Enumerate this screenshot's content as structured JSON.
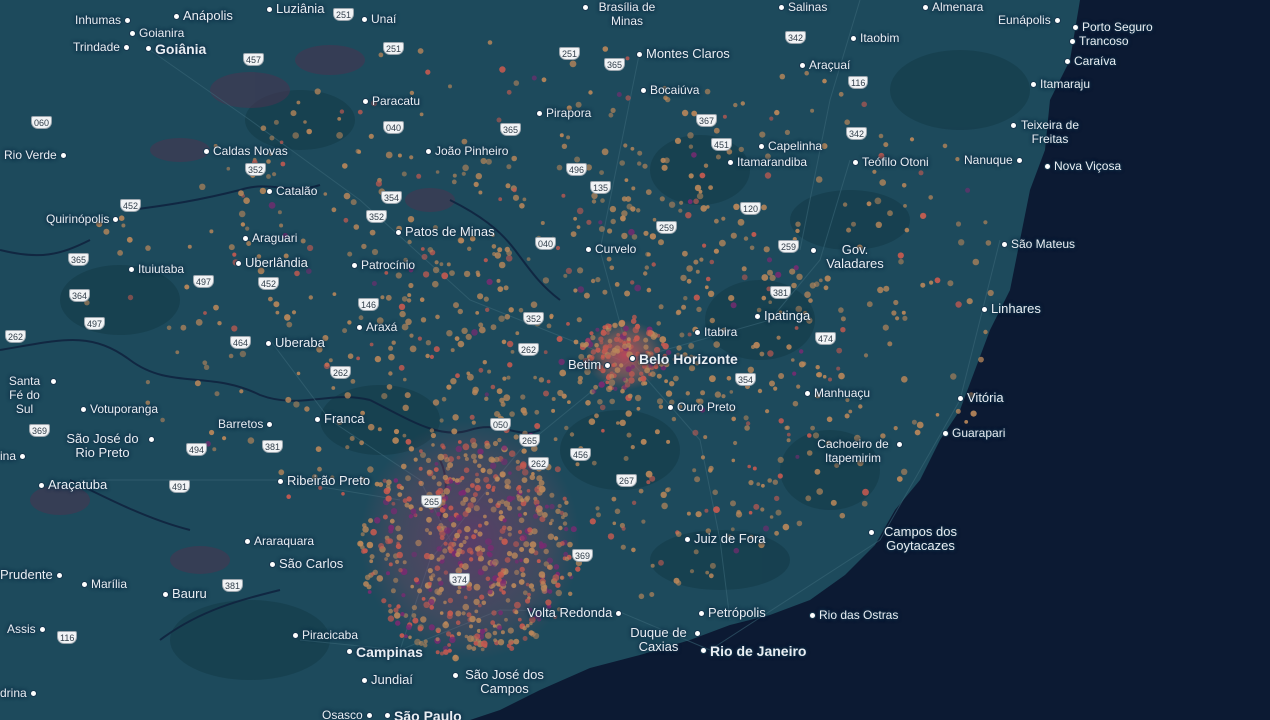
{
  "colors": {
    "ocean": "#0c1a33",
    "land": "#1d4a5c",
    "forest": "#17404f",
    "urban": "#4a3450",
    "heat_low": "#b9875a",
    "heat_mid": "#c65a50",
    "heat_high": "#7a2a72",
    "label": "#e9eef3",
    "shield_bg": "#f1f3f5"
  },
  "cities": [
    {
      "name": "Inhumas",
      "size": "small"
    },
    {
      "name": "Anápolis",
      "size": "medium"
    },
    {
      "name": "Luziânia",
      "size": "medium"
    },
    {
      "name": "Unaí",
      "size": "small"
    },
    {
      "name": "Goianira",
      "size": "small"
    },
    {
      "name": "Trindade",
      "size": "small"
    },
    {
      "name": "Goiânia",
      "size": "major"
    },
    {
      "name": "Brasília de Minas",
      "size": "small"
    },
    {
      "name": "Salinas",
      "size": "small"
    },
    {
      "name": "Almenara",
      "size": "small"
    },
    {
      "name": "Eunápolis",
      "size": "small"
    },
    {
      "name": "Porto Seguro",
      "size": "small"
    },
    {
      "name": "Trancoso",
      "size": "small"
    },
    {
      "name": "Montes Claros",
      "size": "medium"
    },
    {
      "name": "Itaobim",
      "size": "small"
    },
    {
      "name": "Caraíva",
      "size": "small"
    },
    {
      "name": "Araçuaí",
      "size": "small"
    },
    {
      "name": "Itamaraju",
      "size": "small"
    },
    {
      "name": "Bocaiúva",
      "size": "small"
    },
    {
      "name": "Paracatu",
      "size": "small"
    },
    {
      "name": "Pirapora",
      "size": "small"
    },
    {
      "name": "Teixeira de Freitas",
      "size": "small"
    },
    {
      "name": "Rio Verde",
      "size": "small"
    },
    {
      "name": "Caldas Novas",
      "size": "small"
    },
    {
      "name": "João Pinheiro",
      "size": "small"
    },
    {
      "name": "Capelinha",
      "size": "small"
    },
    {
      "name": "Itamarandiba",
      "size": "small"
    },
    {
      "name": "Teófilo Otoni",
      "size": "small"
    },
    {
      "name": "Nanuque",
      "size": "small"
    },
    {
      "name": "Nova Viçosa",
      "size": "small"
    },
    {
      "name": "Catalão",
      "size": "small"
    },
    {
      "name": "Quirinópolis",
      "size": "small"
    },
    {
      "name": "Patos de Minas",
      "size": "medium"
    },
    {
      "name": "Araguari",
      "size": "small"
    },
    {
      "name": "Curvelo",
      "size": "small"
    },
    {
      "name": "Gov. Valadares",
      "size": "medium"
    },
    {
      "name": "São Mateus",
      "size": "small"
    },
    {
      "name": "Uberlândia",
      "size": "medium"
    },
    {
      "name": "Ituiutaba",
      "size": "small"
    },
    {
      "name": "Patrocínio",
      "size": "small"
    },
    {
      "name": "Linhares",
      "size": "medium"
    },
    {
      "name": "Itabira",
      "size": "small"
    },
    {
      "name": "Ipatinga",
      "size": "medium"
    },
    {
      "name": "Araxá",
      "size": "small"
    },
    {
      "name": "Uberaba",
      "size": "medium"
    },
    {
      "name": "Betim",
      "size": "medium"
    },
    {
      "name": "Belo Horizonte",
      "size": "major"
    },
    {
      "name": "Santa Fé do Sul",
      "size": "small"
    },
    {
      "name": "Manhuaçu",
      "size": "small"
    },
    {
      "name": "Vitória",
      "size": "medium"
    },
    {
      "name": "Votuporanga",
      "size": "small"
    },
    {
      "name": "Barretos",
      "size": "small"
    },
    {
      "name": "Franca",
      "size": "medium"
    },
    {
      "name": "Ouro Preto",
      "size": "small"
    },
    {
      "name": "Guarapari",
      "size": "small"
    },
    {
      "name": "São José do Rio Preto",
      "size": "medium"
    },
    {
      "name": "Cachoeiro de Itapemirim",
      "size": "small"
    },
    {
      "name": "ina",
      "size": "small"
    },
    {
      "name": "Araçatuba",
      "size": "medium"
    },
    {
      "name": "Ribeirão Preto",
      "size": "medium"
    },
    {
      "name": "Juiz de Fora",
      "size": "medium"
    },
    {
      "name": "Araraquara",
      "size": "small"
    },
    {
      "name": "Campos dos Goytacazes",
      "size": "medium"
    },
    {
      "name": "São Carlos",
      "size": "medium"
    },
    {
      "name": "Prudente",
      "size": "medium"
    },
    {
      "name": "Marília",
      "size": "small"
    },
    {
      "name": "Bauru",
      "size": "medium"
    },
    {
      "name": "Volta Redonda",
      "size": "medium"
    },
    {
      "name": "Petrópolis",
      "size": "medium"
    },
    {
      "name": "Rio das Ostras",
      "size": "small"
    },
    {
      "name": "Assis",
      "size": "small"
    },
    {
      "name": "Piracicaba",
      "size": "small"
    },
    {
      "name": "Duque de Caxias",
      "size": "medium"
    },
    {
      "name": "Campinas",
      "size": "major"
    },
    {
      "name": "Rio de Janeiro",
      "size": "major"
    },
    {
      "name": "Jundiaí",
      "size": "medium"
    },
    {
      "name": "São José dos Campos",
      "size": "medium"
    },
    {
      "name": "drina",
      "size": "small"
    },
    {
      "name": "Osasco",
      "size": "small"
    },
    {
      "name": "São Paulo",
      "size": "major"
    }
  ],
  "highways": [
    "251",
    "251",
    "251",
    "457",
    "342",
    "365",
    "116",
    "060",
    "040",
    "365",
    "367",
    "451",
    "342",
    "352",
    "496",
    "135",
    "354",
    "452",
    "120",
    "352",
    "259",
    "040",
    "365",
    "497",
    "452",
    "259",
    "381",
    "364",
    "146",
    "352",
    "474",
    "497",
    "262",
    "464",
    "262",
    "262",
    "354",
    "369",
    "050",
    "265",
    "381",
    "494",
    "262",
    "456",
    "491",
    "265",
    "267",
    "369",
    "381",
    "374",
    "116"
  ]
}
